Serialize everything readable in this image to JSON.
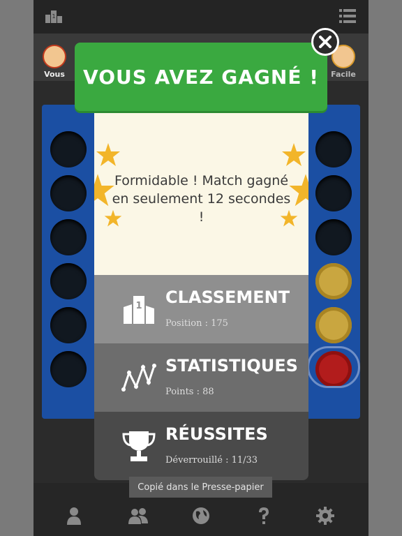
{
  "players": {
    "left_label": "Vous",
    "right_label": "Facile"
  },
  "dialog": {
    "title": "VOUS AVEZ GAGNÉ !",
    "message": "Formidable ! Match gagné en seulement 12 secondes !",
    "rows": [
      {
        "title": "CLASSEMENT",
        "subtitle": "Position : 175",
        "icon": "podium-icon"
      },
      {
        "title": "STATISTIQUES",
        "subtitle": "Points : 88",
        "icon": "stats-line-icon"
      },
      {
        "title": "RÉUSSITES",
        "subtitle": "Déverrouillé : 11/33",
        "icon": "trophy-icon"
      }
    ]
  },
  "toast": "Copié dans le Presse-papier",
  "nav_icons": [
    "person-icon",
    "two-players-icon",
    "globe-icon",
    "help-icon",
    "gear-icon"
  ],
  "colors": {
    "banner": "#3aa940",
    "board": "#1b4fa3",
    "star": "#f2b52a",
    "yellow_token": "#c9a640",
    "red_token": "#b21c1c"
  }
}
